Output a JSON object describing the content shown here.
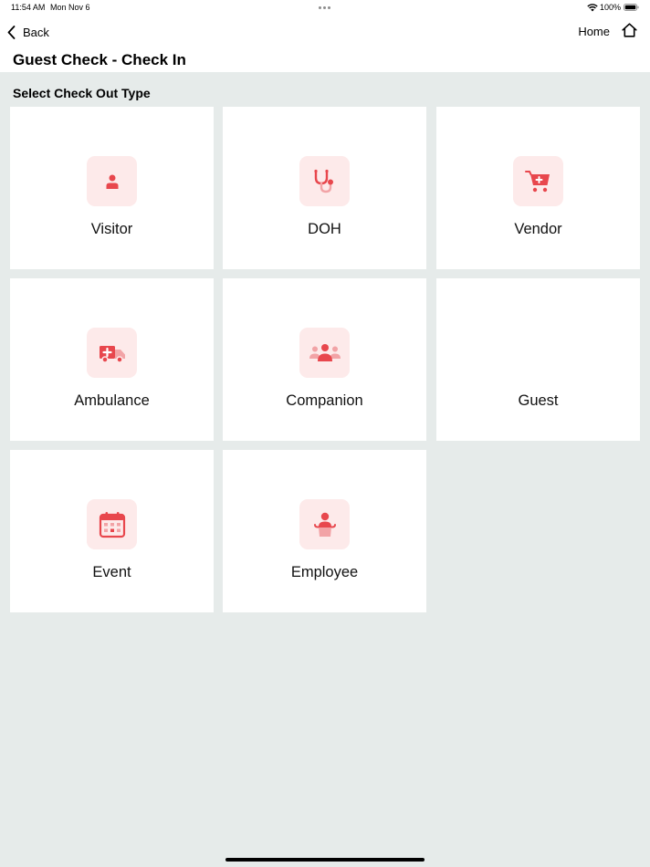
{
  "status_bar": {
    "time": "11:54 AM",
    "date": "Mon Nov 6",
    "battery": "100%"
  },
  "nav": {
    "back_label": "Back",
    "home_label": "Home"
  },
  "page_title": "Guest Check - Check In",
  "section_title": "Select Check Out Type",
  "tiles": [
    {
      "label": "Visitor",
      "icon": "person-icon"
    },
    {
      "label": "DOH",
      "icon": "stethoscope-icon"
    },
    {
      "label": "Vendor",
      "icon": "medical-cart-icon"
    },
    {
      "label": "Ambulance",
      "icon": "ambulance-icon"
    },
    {
      "label": "Companion",
      "icon": "group-icon"
    },
    {
      "label": "Guest",
      "icon": ""
    },
    {
      "label": "Event",
      "icon": "calendar-icon"
    },
    {
      "label": "Employee",
      "icon": "employee-icon"
    }
  ],
  "colors": {
    "accent": "#e8474d",
    "icon_bg": "#fdeaea",
    "page_bg": "#e6ebea"
  }
}
